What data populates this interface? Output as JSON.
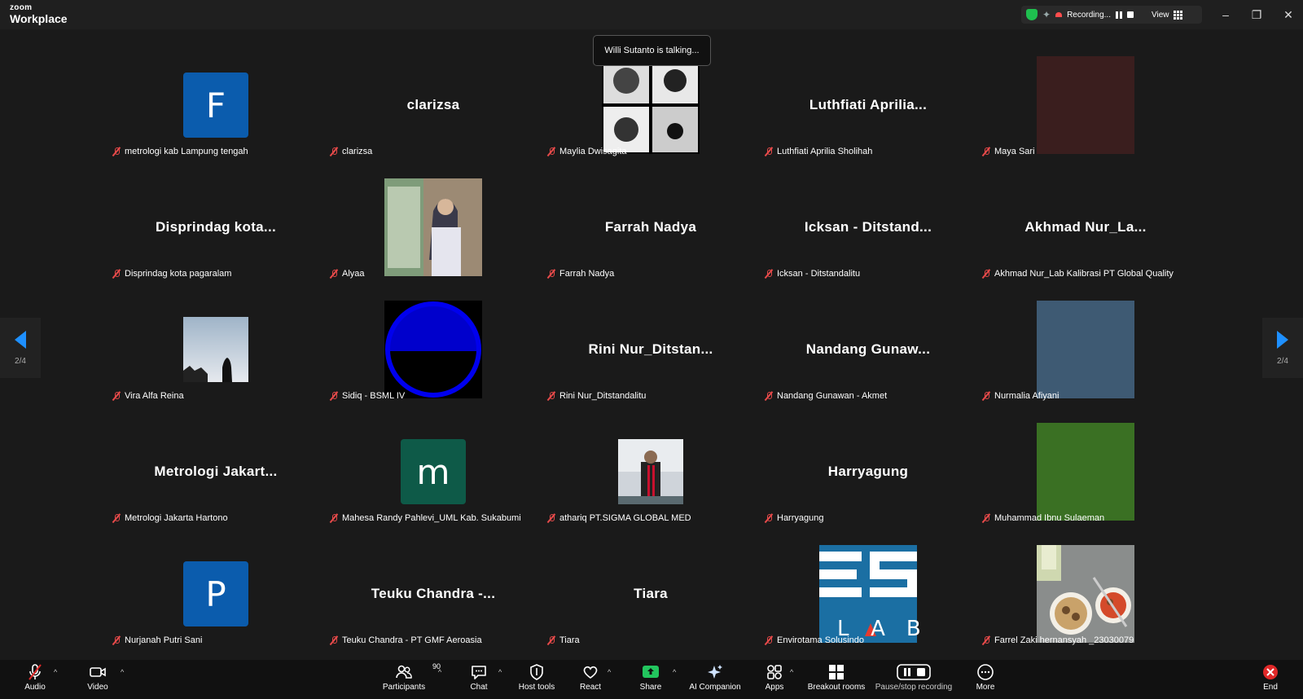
{
  "titlebar": {
    "logo_top": "zoom",
    "logo_bottom": "Workplace",
    "recording_label": "Recording...",
    "view_label": "View",
    "minimize": "–",
    "restore": "❐",
    "close": "✕"
  },
  "talking_indicator": "Willi Sutanto is talking...",
  "pager": {
    "left_page": "2/4",
    "right_page": "2/4"
  },
  "participants": [
    {
      "display": "F",
      "label": "metrologi kab Lampung tengah",
      "kind": "letter",
      "color": "#0b5cad"
    },
    {
      "display": "clarizsa",
      "label": "clarizsa",
      "kind": "name"
    },
    {
      "display": "",
      "label": "Maylia Dwisagita",
      "kind": "photo-bw"
    },
    {
      "display": "Luthfiati  Aprilia...",
      "label": "Luthfiati Aprilia Sholihah",
      "kind": "name"
    },
    {
      "display": "",
      "label": "Maya Sari",
      "kind": "color",
      "color": "#3a1e1e"
    },
    {
      "display": "Disprindag  kota...",
      "label": "Disprindag kota pagaralam",
      "kind": "name"
    },
    {
      "display": "",
      "label": "Alyaa",
      "kind": "photo-window"
    },
    {
      "display": "Farrah Nadya",
      "label": "Farrah Nadya",
      "kind": "name"
    },
    {
      "display": "Icksan - Ditstand...",
      "label": "Icksan - Ditstandalitu",
      "kind": "name"
    },
    {
      "display": "Akhmad  Nur_La...",
      "label": "Akhmad Nur_Lab Kalibrasi PT Global Quality",
      "kind": "name"
    },
    {
      "display": "",
      "label": "Vira Alfa Reina",
      "kind": "photo-sky"
    },
    {
      "display": "",
      "label": "Sidiq - BSML IV",
      "kind": "photo-circle"
    },
    {
      "display": "Rini  Nur_Ditstan...",
      "label": "Rini Nur_Ditstandalitu",
      "kind": "name"
    },
    {
      "display": "Nandang  Gunaw...",
      "label": "Nandang Gunawan - Akmet",
      "kind": "name"
    },
    {
      "display": "",
      "label": "Nurmalia Afiyani",
      "kind": "color",
      "color": "#3e5a73"
    },
    {
      "display": "Metrologi  Jakart...",
      "label": "Metrologi Jakarta Hartono",
      "kind": "name"
    },
    {
      "display": "m",
      "label": "Mahesa Randy Pahlevi_UML Kab. Sukabumi",
      "kind": "letter",
      "color": "#0e5a48"
    },
    {
      "display": "",
      "label": "athariq PT.SIGMA GLOBAL MED",
      "kind": "photo-person"
    },
    {
      "display": "Harryagung",
      "label": "Harryagung",
      "kind": "name"
    },
    {
      "display": "",
      "label": "Muhammad Ibnu Sulaeman",
      "kind": "color",
      "color": "#3a7023"
    },
    {
      "display": "P",
      "label": "Nurjanah Putri Sani",
      "kind": "letter",
      "color": "#0b5cad"
    },
    {
      "display": "Teuku Chandra -...",
      "label": "Teuku Chandra - PT GMF Aeroasia",
      "kind": "name"
    },
    {
      "display": "Tiara",
      "label": "Tiara",
      "kind": "name"
    },
    {
      "display": "",
      "label": "Envirotama Solusindo",
      "kind": "logo-eslab",
      "logo_text": "LAB"
    },
    {
      "display": "",
      "label": "Farrel Zaki hernansyah _23030079",
      "kind": "photo-food"
    }
  ],
  "toolbar": {
    "audio": "Audio",
    "video": "Video",
    "participants": "Participants",
    "participants_count": "90",
    "chat": "Chat",
    "host_tools": "Host tools",
    "react": "React",
    "share": "Share",
    "ai_companion": "AI Companion",
    "apps": "Apps",
    "breakout": "Breakout rooms",
    "pause_recording": "Pause/stop recording",
    "more": "More",
    "end": "End"
  },
  "colors": {
    "background": "#1a1a1a",
    "share_green": "#22c55e",
    "end_red": "#e02828",
    "pager_blue": "#1e90ff"
  }
}
